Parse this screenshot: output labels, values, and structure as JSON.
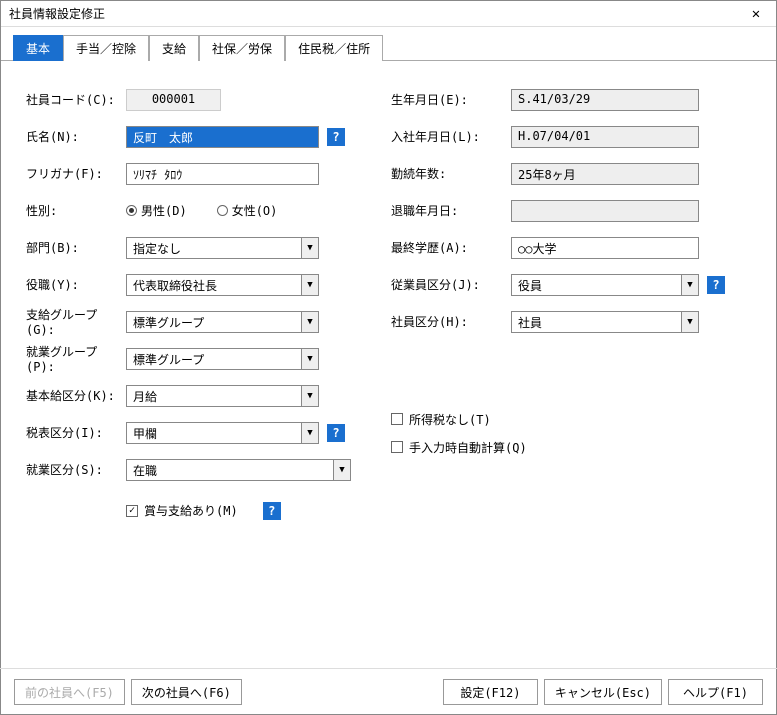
{
  "window_title": "社員情報設定修正",
  "tabs": [
    "基本",
    "手当／控除",
    "支給",
    "社保／労保",
    "住民税／住所"
  ],
  "active_tab": 0,
  "labels_left": {
    "emp_code": "社員コード(C):",
    "name": "氏名(N):",
    "furigana": "フリガナ(F):",
    "gender": "性別:",
    "gender_m": "男性(D)",
    "gender_f": "女性(O)",
    "department": "部門(B):",
    "position": "役職(Y):",
    "pay_group": "支給グループ(G):",
    "work_group": "就業グループ(P):",
    "base_pay": "基本給区分(K):",
    "tax_table": "税表区分(I):",
    "work_status": "就業区分(S):",
    "bonus": "賞与支給あり(M)"
  },
  "labels_right": {
    "birthdate": "生年月日(E):",
    "hiredate": "入社年月日(L):",
    "tenure": "勤続年数:",
    "retiredate": "退職年月日:",
    "education": "最終学歴(A):",
    "emp_type": "従業員区分(J):",
    "emp_class": "社員区分(H):",
    "no_tax": "所得税なし(T)",
    "auto_calc": "手入力時自動計算(Q)"
  },
  "values": {
    "emp_code": "000001",
    "name": "反町　太郎",
    "furigana": "ｿﾘﾏﾁ ﾀﾛｳ",
    "department": "指定なし",
    "position": "代表取締役社長",
    "pay_group": "標準グループ",
    "work_group": "標準グループ",
    "base_pay": "月給",
    "tax_table": "甲欄",
    "work_status": "在職",
    "birthdate": "S.41/03/29",
    "hiredate": "H.07/04/01",
    "tenure": "25年8ヶ月",
    "retiredate": "",
    "education": "○○大学",
    "emp_type": "役員",
    "emp_class": "社員"
  },
  "buttons": {
    "prev": "前の社員へ(F5)",
    "next": "次の社員へ(F6)",
    "settings": "設定(F12)",
    "cancel": "キャンセル(Esc)",
    "help": "ヘルプ(F1)"
  },
  "help_icon": "?",
  "close_icon": "✕",
  "dd_icon": "▼"
}
